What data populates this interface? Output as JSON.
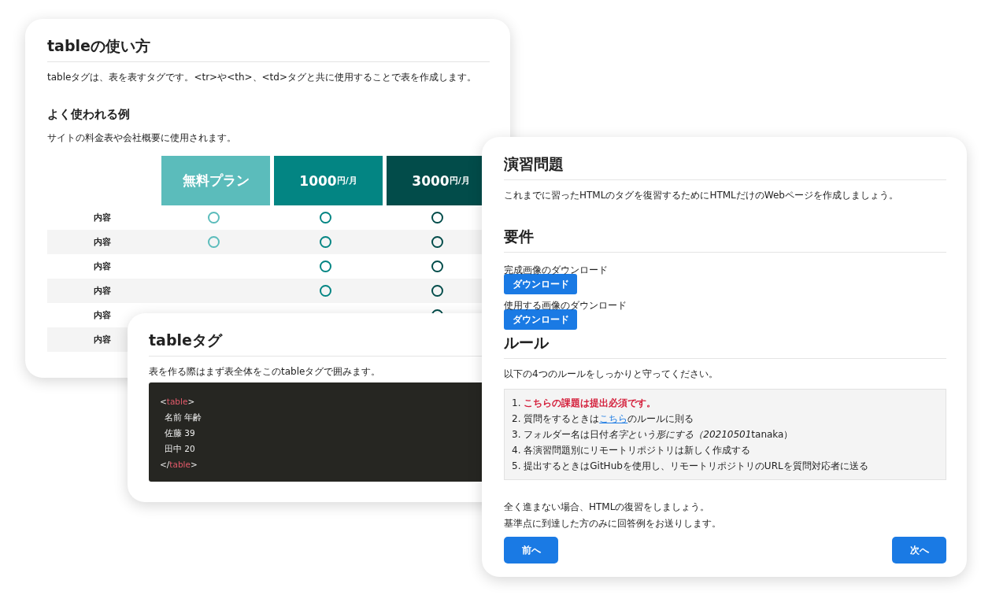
{
  "table_card": {
    "title": "tableの使い方",
    "intro": "tableタグは、表を表すタグです。<tr>や<th>、<td>タグと共に使用することで表を作成します。",
    "subtitle": "よく使われる例",
    "caption": "サイトの料金表や会社概要に使用されます。",
    "columns": [
      {
        "kind": "name",
        "label": "無料プラン",
        "color": "#5bbcbb"
      },
      {
        "kind": "price",
        "price": "1000",
        "unit": "円/月",
        "color": "#038583"
      },
      {
        "kind": "price",
        "price": "3000",
        "unit": "円/月",
        "color": "#024c4a"
      }
    ],
    "rows": [
      {
        "label": "内容",
        "marked": [
          true,
          true,
          true
        ]
      },
      {
        "label": "内容",
        "marked": [
          true,
          true,
          true
        ]
      },
      {
        "label": "内容",
        "marked": [
          false,
          true,
          true
        ]
      },
      {
        "label": "内容",
        "marked": [
          false,
          true,
          true
        ]
      },
      {
        "label": "内容",
        "marked": [
          false,
          false,
          true
        ]
      },
      {
        "label": "内容"
      }
    ]
  },
  "tag_card": {
    "title": "tableタグ",
    "text": "表を作る際はまず表全体をこのtableタグで囲みます。",
    "code": [
      {
        "kind": "tag",
        "open": "<",
        "name": "table",
        "close": ">"
      },
      {
        "kind": "text",
        "text": "名前 年齢"
      },
      {
        "kind": "text",
        "text": "佐藤 39"
      },
      {
        "kind": "text",
        "text": "田中 20"
      },
      {
        "kind": "tag",
        "open": "</",
        "name": "table",
        "close": ">"
      }
    ]
  },
  "exercise_card": {
    "title": "演習問題",
    "intro": "これまでに習ったHTMLのタグを復習するためにHTMLだけのWebページを作成しましょう。",
    "requirements_title": "要件",
    "downloads": [
      {
        "label": "完成画像のダウンロード",
        "button": "ダウンロード"
      },
      {
        "label": "使用する画像のダウンロード",
        "button": "ダウンロード"
      }
    ],
    "rules_title": "ルール",
    "rules_intro": "以下の4つのルールをしっかりと守ってください。",
    "rules": [
      {
        "kind": "required",
        "number": "1.",
        "text": "こちらの課題は提出必須です。"
      },
      {
        "kind": "link",
        "number": "2.",
        "before": "質問をするときは",
        "link": "こちら",
        "after": "のルールに則る"
      },
      {
        "kind": "italic",
        "number": "3.",
        "before": "フォルダー名は日付",
        "italic": "名字という形にする（20210501",
        "after": "tanaka）"
      },
      {
        "kind": "plain",
        "number": "4.",
        "text": "各演習問題別にリモートリポジトリは新しく作成する"
      },
      {
        "kind": "plain",
        "number": "5.",
        "text": "提出するときはGitHubを使用し、リモートリポジトリのURLを質問対応者に送る"
      }
    ],
    "notes": [
      "全く進まない場合、HTMLの復習をしましょう。",
      "基準点に到達した方のみに回答例をお送りします。"
    ],
    "prev_button": "前へ",
    "next_button": "次へ"
  }
}
